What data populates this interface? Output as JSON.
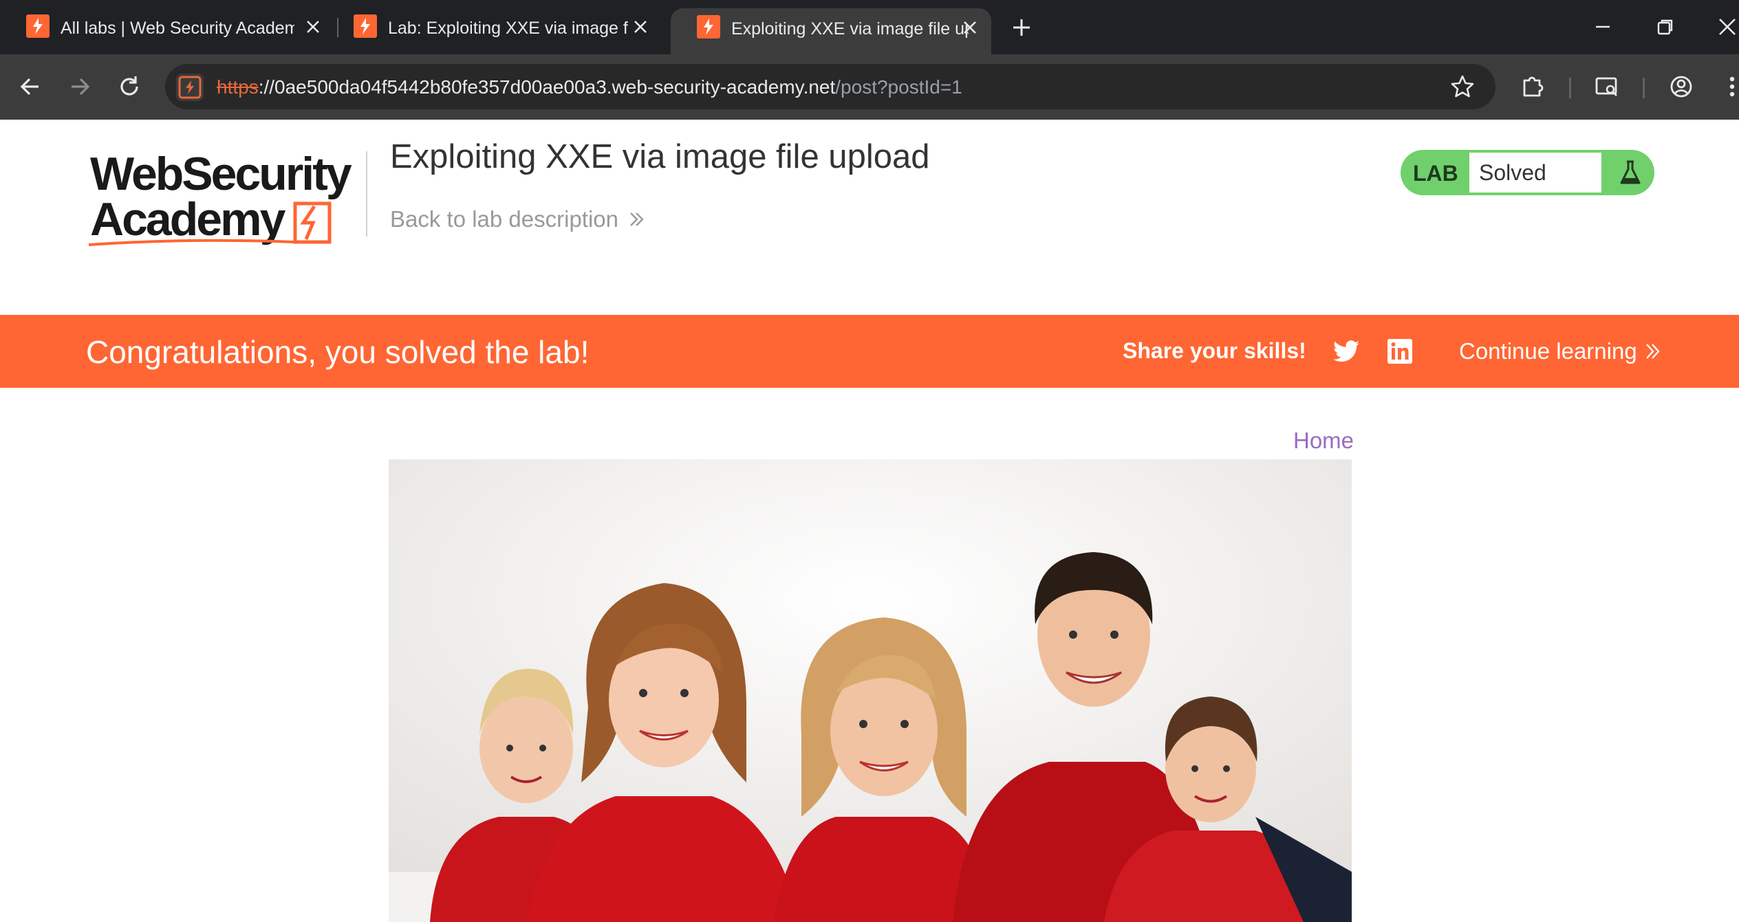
{
  "browser": {
    "tabs": [
      {
        "title": "All labs | Web Security Academy",
        "active": false
      },
      {
        "title": "Lab: Exploiting XXE via image file upload",
        "active": false
      },
      {
        "title": "Exploiting XXE via image file upload",
        "active": true
      }
    ],
    "url": {
      "scheme": "https",
      "host": "://0ae500da04f5442b80fe357d00ae00a3.web-security-academy.net",
      "path": "/post?postId=1"
    }
  },
  "header": {
    "logo_line1": "WebSecurity",
    "logo_line2": "Academy",
    "lab_title": "Exploiting XXE via image file upload",
    "back_link": "Back to lab description"
  },
  "lab_badge": {
    "label": "LAB",
    "status": "Solved"
  },
  "banner": {
    "message": "Congratulations, you solved the lab!",
    "share_label": "Share your skills!",
    "continue_label": "Continue learning"
  },
  "nav": {
    "home": "Home"
  },
  "colors": {
    "brand_orange": "#ff6633",
    "badge_green": "#70d06c",
    "home_link": "#9a6bc0"
  }
}
